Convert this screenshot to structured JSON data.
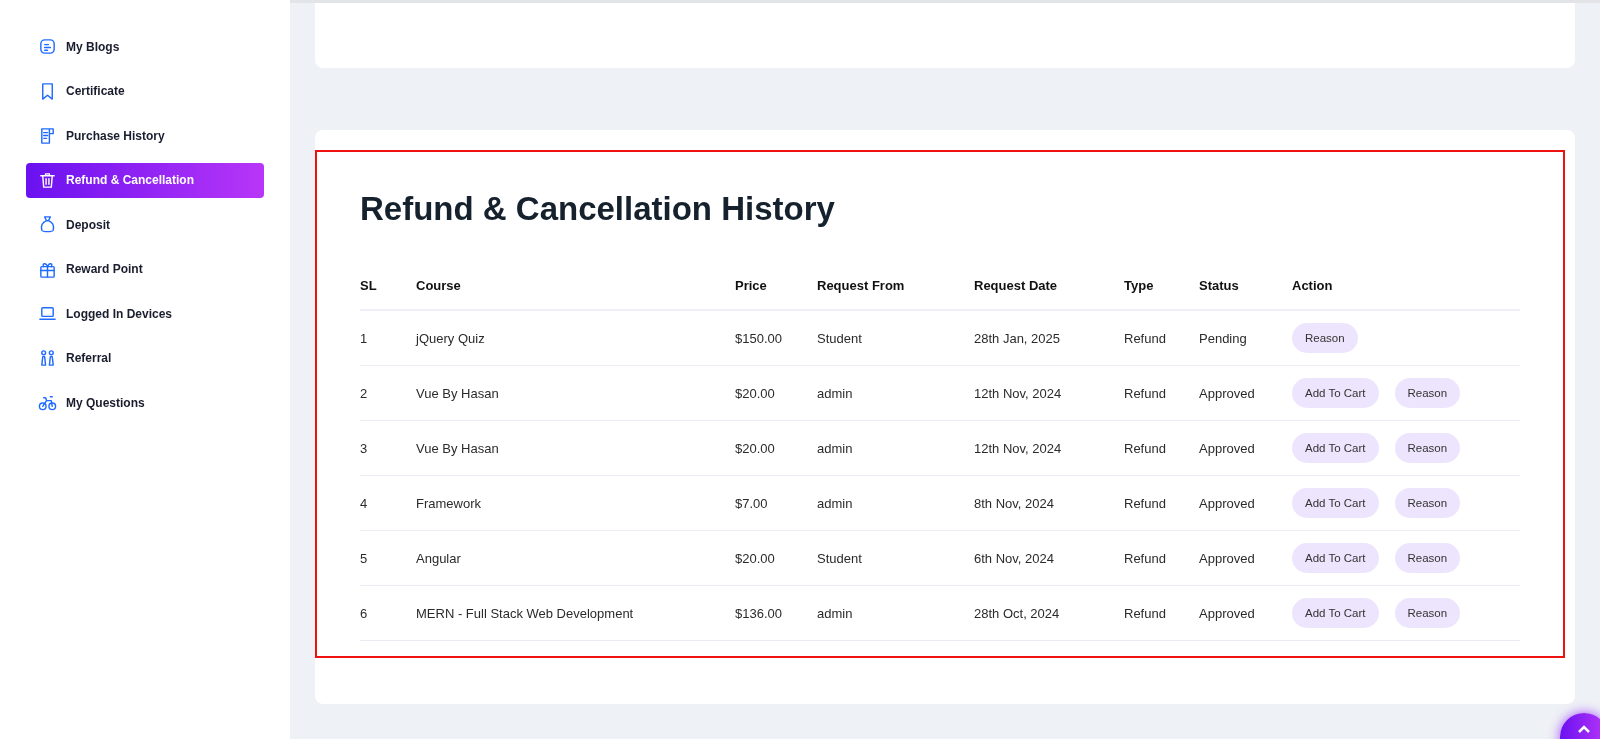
{
  "sidebar": {
    "items": [
      {
        "label": "My Blogs",
        "kind": "blog",
        "selected": false
      },
      {
        "label": "Certificate",
        "kind": "bookmark",
        "selected": false
      },
      {
        "label": "Purchase History",
        "kind": "receipt",
        "selected": false
      },
      {
        "label": "Refund & Cancellation",
        "kind": "trash",
        "selected": true
      },
      {
        "label": "Deposit",
        "kind": "bag",
        "selected": false
      },
      {
        "label": "Reward Point",
        "kind": "gift",
        "selected": false
      },
      {
        "label": "Logged In Devices",
        "kind": "laptop",
        "selected": false
      },
      {
        "label": "Referral",
        "kind": "people",
        "selected": false
      },
      {
        "label": "My Questions",
        "kind": "bike",
        "selected": false
      }
    ]
  },
  "refund_history": {
    "title": "Refund & Cancellation History",
    "table": {
      "columns": [
        "SL",
        "Course",
        "Price",
        "Request From",
        "Request Date",
        "Type",
        "Status",
        "Action"
      ],
      "rows": [
        {
          "sl": "1",
          "course": "jQuery Quiz",
          "price": "$150.00",
          "request_from": "Student",
          "request_date": "28th Jan, 2025",
          "type": "Refund",
          "status": "Pending",
          "actions": [
            "Reason"
          ]
        },
        {
          "sl": "2",
          "course": "Vue By Hasan",
          "price": "$20.00",
          "request_from": "admin",
          "request_date": "12th Nov, 2024",
          "type": "Refund",
          "status": "Approved",
          "actions": [
            "Add To Cart",
            "Reason"
          ]
        },
        {
          "sl": "3",
          "course": "Vue By Hasan",
          "price": "$20.00",
          "request_from": "admin",
          "request_date": "12th Nov, 2024",
          "type": "Refund",
          "status": "Approved",
          "actions": [
            "Add To Cart",
            "Reason"
          ]
        },
        {
          "sl": "4",
          "course": "Framework",
          "price": "$7.00",
          "request_from": "admin",
          "request_date": "8th Nov, 2024",
          "type": "Refund",
          "status": "Approved",
          "actions": [
            "Add To Cart",
            "Reason"
          ]
        },
        {
          "sl": "5",
          "course": "Angular",
          "price": "$20.00",
          "request_from": "Student",
          "request_date": "6th Nov, 2024",
          "type": "Refund",
          "status": "Approved",
          "actions": [
            "Add To Cart",
            "Reason"
          ]
        },
        {
          "sl": "6",
          "course": "MERN - Full Stack Web Development",
          "price": "$136.00",
          "request_from": "admin",
          "request_date": "28th Oct, 2024",
          "type": "Refund",
          "status": "Approved",
          "actions": [
            "Add To Cart",
            "Reason"
          ]
        }
      ]
    }
  }
}
